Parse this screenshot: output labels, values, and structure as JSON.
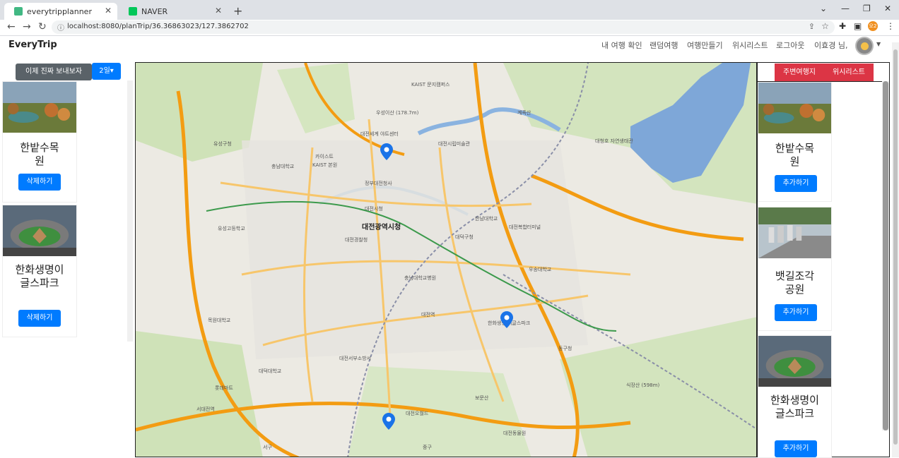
{
  "browser": {
    "tabs": [
      {
        "title": "everytripplanner",
        "active": true
      },
      {
        "title": "NAVER",
        "active": false
      }
    ],
    "url": "localhost:8080/planTrip/36.36863023/127.3862702",
    "profile_initials": "오2"
  },
  "app": {
    "brand": "EveryTrip",
    "menu": [
      "내 여행 확인",
      "랜덤여행",
      "여행만들기",
      "위시리스트",
      "로그아웃",
      "이효경 님,"
    ]
  },
  "left": {
    "send_button": "이제 진짜 보내보자",
    "day_dropdown": "2일▾",
    "cards": [
      {
        "title": "한밭수목원",
        "action": "삭제하기"
      },
      {
        "title": "한화생명이글스파크",
        "action": "삭제하기"
      }
    ]
  },
  "right": {
    "tabs": [
      "주변여행지",
      "위시리스트"
    ],
    "cards": [
      {
        "title": "한밭수목원",
        "action": "추가하기"
      },
      {
        "title": "뱃길조각공원",
        "action": "추가하기"
      },
      {
        "title": "한화생명이글스파크",
        "action": "추가하기"
      }
    ]
  },
  "map": {
    "labels": [
      "대전광역시청",
      "대전세계 야트센터",
      "정부대전청사",
      "우성이산 (178.7m)",
      "유성구청",
      "충남대학교",
      "KAIST 문지캠퍼스",
      "한남대학교",
      "대덕구청",
      "대전역",
      "동구청",
      "대전오월드",
      "식장산 (598m)",
      "계족산",
      "대청호 자연생태관",
      "유성고등학교",
      "목원대학교",
      "서대전역",
      "중구",
      "서구",
      "보문산",
      "대전동물원",
      "대전복합터미널",
      "충남대학교병원",
      "대전시립미술관",
      "카이스트",
      "한화생명 이글스파크",
      "대전서부소방서",
      "대덕대학교",
      "대전시청",
      "우송대학교",
      "대전경찰청",
      "롯데마트",
      "KAIST 본원"
    ],
    "colors": {
      "road": "#f5b041",
      "highway": "#f39c12",
      "park": "#c8dfb0",
      "water": "#7da6d9",
      "pin": "#1a73e8"
    }
  }
}
